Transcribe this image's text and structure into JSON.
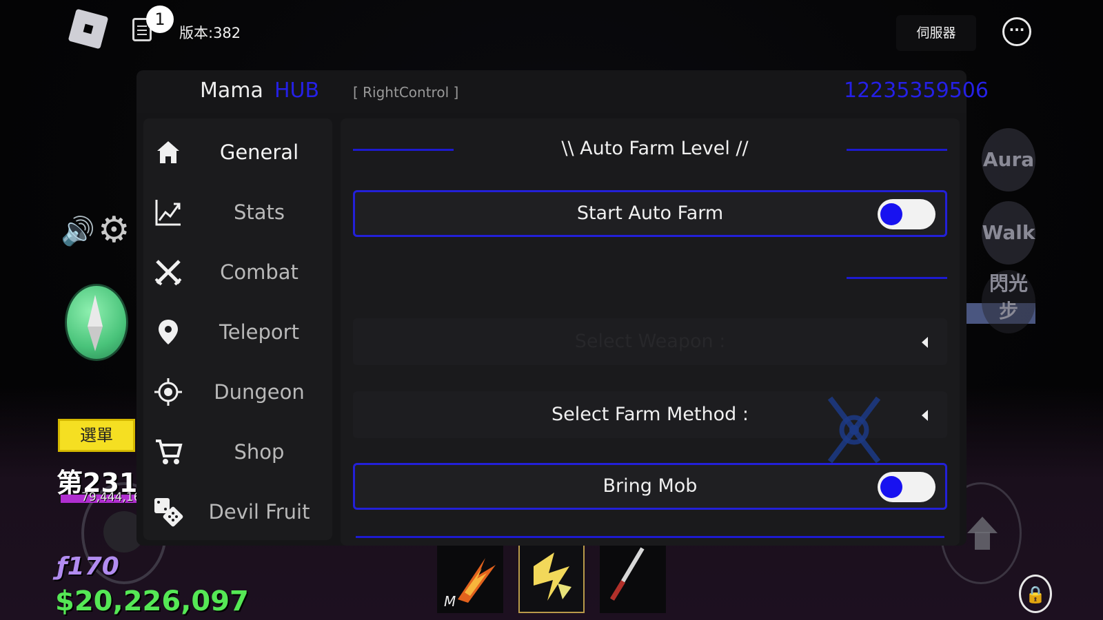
{
  "top_bar": {
    "notification_count": "1",
    "version_text": "版本:382",
    "server_button": "伺服器",
    "more_button": "···"
  },
  "hud_left": {
    "menu_button": "選單",
    "level_text": "第2313",
    "xp_text": "79,444,16",
    "fragments": "ƒ170",
    "money": "$20,226,097"
  },
  "hud_right": {
    "buttons": [
      "Aura",
      "Walk",
      "閃光步"
    ]
  },
  "hub": {
    "title_main": "Mama",
    "title_accent": "HUB",
    "keybind": "[ RightControl ]",
    "user_id": "12235359506",
    "accent_color": "#2520e6",
    "nav": [
      {
        "label": "General",
        "icon": "home-icon",
        "active": true
      },
      {
        "label": "Stats",
        "icon": "chart-line-icon",
        "active": false
      },
      {
        "label": "Combat",
        "icon": "crossed-swords-icon",
        "active": false
      },
      {
        "label": "Teleport",
        "icon": "map-pin-icon",
        "active": false
      },
      {
        "label": "Dungeon",
        "icon": "crosshair-icon",
        "active": false
      },
      {
        "label": "Shop",
        "icon": "shopping-cart-icon",
        "active": false
      },
      {
        "label": "Devil Fruit",
        "icon": "dice-icon",
        "active": false
      }
    ],
    "content": {
      "section_title": "\\\\ Auto Farm Level //",
      "start_auto_farm": {
        "label": "Start Auto Farm",
        "enabled": true
      },
      "weapon_dropdown": {
        "label": "Select Weapon :"
      },
      "farm_method_dropdown": {
        "label": "Select Farm Method :"
      },
      "bring_mob": {
        "label": "Bring Mob",
        "enabled": true
      }
    }
  }
}
